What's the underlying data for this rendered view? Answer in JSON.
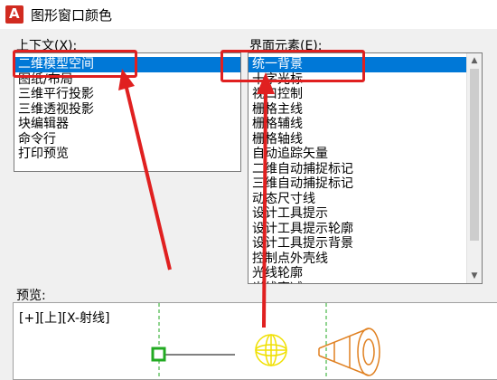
{
  "window": {
    "title": "图形窗口颜色",
    "icon": "autocad-app-icon"
  },
  "context": {
    "label": "上下文(X):",
    "items": [
      "二维模型空间",
      "图纸/布局",
      "三维平行投影",
      "三维透视投影",
      "块编辑器",
      "命令行",
      "打印预览"
    ],
    "selected": "二维模型空间"
  },
  "elements": {
    "label": "界面元素(E):",
    "items": [
      "统一背景",
      "十字光标",
      "视口控制",
      "栅格主线",
      "栅格辅线",
      "栅格轴线",
      "自动追踪矢量",
      "二维自动捕捉标记",
      "三维自动捕捉标记",
      "动态尺寸线",
      "设计工具提示",
      "设计工具提示轮廓",
      "设计工具提示背景",
      "控制点外壳线",
      "光线轮廓",
      "光线衰减"
    ],
    "selected": "统一背景"
  },
  "preview": {
    "label": "预览:",
    "viewport_label": "[+][上][X-射线]"
  },
  "colors": {
    "selection": "#0078d7",
    "annotation": "#e02020",
    "preview_green": "#22aa22",
    "preview_yellow": "#f0e000",
    "preview_orange": "#e08020"
  }
}
